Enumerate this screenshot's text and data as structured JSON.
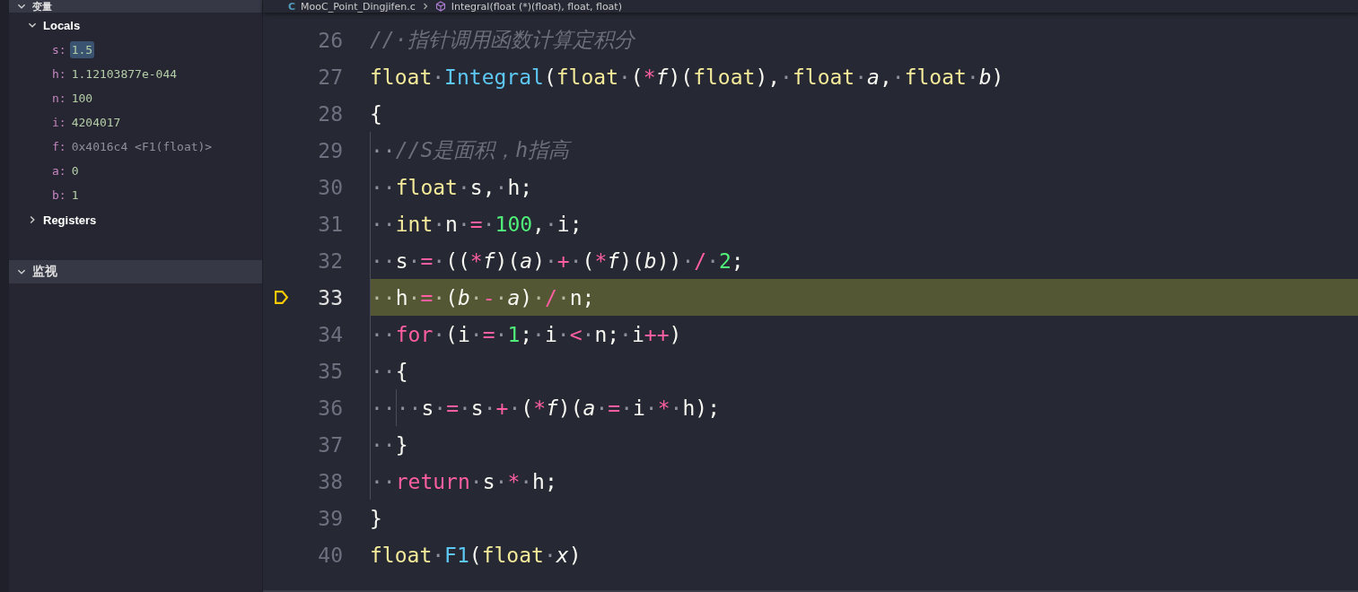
{
  "sidebar": {
    "section_title": "变量",
    "scopes": [
      {
        "label": "Locals",
        "expanded": true,
        "variables": [
          {
            "name": "s:",
            "value": "1.5",
            "selected": true,
            "kind": "number"
          },
          {
            "name": "h:",
            "value": "1.12103877e-044",
            "selected": false,
            "kind": "number"
          },
          {
            "name": "n:",
            "value": "100",
            "selected": false,
            "kind": "number"
          },
          {
            "name": "i:",
            "value": "4204017",
            "selected": false,
            "kind": "number"
          },
          {
            "name": "f:",
            "value": "0x4016c4 <F1(float)>",
            "selected": false,
            "kind": "pointer"
          },
          {
            "name": "a:",
            "value": "0",
            "selected": false,
            "kind": "number"
          },
          {
            "name": "b:",
            "value": "1",
            "selected": false,
            "kind": "number"
          }
        ]
      },
      {
        "label": "Registers",
        "expanded": false
      }
    ],
    "watch": {
      "title": "监视",
      "expanded": true
    }
  },
  "breadcrumb": {
    "file_icon": "C",
    "file": "MooC_Point_Dingjifen.c",
    "symbol": "Integral(float (*)(float), float, float)"
  },
  "editor": {
    "lines": [
      {
        "number": "26",
        "current": false,
        "tokens": [
          {
            "kind": "cm",
            "text": "//·指针调用函数计算定积分"
          }
        ]
      },
      {
        "number": "27",
        "current": false,
        "tokens": [
          {
            "kind": "ty",
            "text": "float"
          },
          {
            "kind": "ws",
            "text": "·"
          },
          {
            "kind": "fn",
            "text": "Integral"
          },
          {
            "kind": "pl",
            "text": "("
          },
          {
            "kind": "ty",
            "text": "float"
          },
          {
            "kind": "ws",
            "text": "·"
          },
          {
            "kind": "pl",
            "text": "("
          },
          {
            "kind": "op",
            "text": "*"
          },
          {
            "kind": "it",
            "text": "f"
          },
          {
            "kind": "pl",
            "text": ")("
          },
          {
            "kind": "ty",
            "text": "float"
          },
          {
            "kind": "pl",
            "text": "),"
          },
          {
            "kind": "ws",
            "text": "·"
          },
          {
            "kind": "ty",
            "text": "float"
          },
          {
            "kind": "ws",
            "text": "·"
          },
          {
            "kind": "it",
            "text": "a"
          },
          {
            "kind": "pl",
            "text": ","
          },
          {
            "kind": "ws",
            "text": "·"
          },
          {
            "kind": "ty",
            "text": "float"
          },
          {
            "kind": "ws",
            "text": "·"
          },
          {
            "kind": "it",
            "text": "b"
          },
          {
            "kind": "pl",
            "text": ")"
          }
        ]
      },
      {
        "number": "28",
        "current": false,
        "tokens": [
          {
            "kind": "pl",
            "text": "{"
          }
        ]
      },
      {
        "number": "29",
        "current": false,
        "tokens": [
          {
            "kind": "ind",
            "text": "··"
          },
          {
            "kind": "cm",
            "text": "//S是面积，h指高"
          }
        ]
      },
      {
        "number": "30",
        "current": false,
        "tokens": [
          {
            "kind": "ind",
            "text": "··"
          },
          {
            "kind": "ty",
            "text": "float"
          },
          {
            "kind": "ws",
            "text": "·"
          },
          {
            "kind": "pl",
            "text": "s,"
          },
          {
            "kind": "ws",
            "text": "·"
          },
          {
            "kind": "pl",
            "text": "h;"
          }
        ]
      },
      {
        "number": "31",
        "current": false,
        "tokens": [
          {
            "kind": "ind",
            "text": "··"
          },
          {
            "kind": "ty",
            "text": "int"
          },
          {
            "kind": "ws",
            "text": "·"
          },
          {
            "kind": "pl",
            "text": "n"
          },
          {
            "kind": "ws",
            "text": "·"
          },
          {
            "kind": "op",
            "text": "="
          },
          {
            "kind": "ws",
            "text": "·"
          },
          {
            "kind": "nu",
            "text": "100"
          },
          {
            "kind": "pl",
            "text": ","
          },
          {
            "kind": "ws",
            "text": "·"
          },
          {
            "kind": "pl",
            "text": "i;"
          }
        ]
      },
      {
        "number": "32",
        "current": false,
        "tokens": [
          {
            "kind": "ind",
            "text": "··"
          },
          {
            "kind": "pl",
            "text": "s"
          },
          {
            "kind": "ws",
            "text": "·"
          },
          {
            "kind": "op",
            "text": "="
          },
          {
            "kind": "ws",
            "text": "·"
          },
          {
            "kind": "pl",
            "text": "(("
          },
          {
            "kind": "op",
            "text": "*"
          },
          {
            "kind": "it",
            "text": "f"
          },
          {
            "kind": "pl",
            "text": ")("
          },
          {
            "kind": "it",
            "text": "a"
          },
          {
            "kind": "pl",
            "text": ")"
          },
          {
            "kind": "ws",
            "text": "·"
          },
          {
            "kind": "op",
            "text": "+"
          },
          {
            "kind": "ws",
            "text": "·"
          },
          {
            "kind": "pl",
            "text": "("
          },
          {
            "kind": "op",
            "text": "*"
          },
          {
            "kind": "it",
            "text": "f"
          },
          {
            "kind": "pl",
            "text": ")("
          },
          {
            "kind": "it",
            "text": "b"
          },
          {
            "kind": "pl",
            "text": "))"
          },
          {
            "kind": "ws",
            "text": "·"
          },
          {
            "kind": "op",
            "text": "/"
          },
          {
            "kind": "ws",
            "text": "·"
          },
          {
            "kind": "nu",
            "text": "2"
          },
          {
            "kind": "pl",
            "text": ";"
          }
        ]
      },
      {
        "number": "33",
        "current": true,
        "tokens": [
          {
            "kind": "ind",
            "text": "··"
          },
          {
            "kind": "pl",
            "text": "h"
          },
          {
            "kind": "ws",
            "text": "·"
          },
          {
            "kind": "op",
            "text": "="
          },
          {
            "kind": "ws",
            "text": "·"
          },
          {
            "kind": "pl",
            "text": "("
          },
          {
            "kind": "it",
            "text": "b"
          },
          {
            "kind": "ws",
            "text": "·"
          },
          {
            "kind": "op",
            "text": "-"
          },
          {
            "kind": "ws",
            "text": "·"
          },
          {
            "kind": "it",
            "text": "a"
          },
          {
            "kind": "pl",
            "text": ")"
          },
          {
            "kind": "ws",
            "text": "·"
          },
          {
            "kind": "op",
            "text": "/"
          },
          {
            "kind": "ws",
            "text": "·"
          },
          {
            "kind": "pl",
            "text": "n;"
          }
        ]
      },
      {
        "number": "34",
        "current": false,
        "tokens": [
          {
            "kind": "ind",
            "text": "··"
          },
          {
            "kind": "kw",
            "text": "for"
          },
          {
            "kind": "ws",
            "text": "·"
          },
          {
            "kind": "pl",
            "text": "(i"
          },
          {
            "kind": "ws",
            "text": "·"
          },
          {
            "kind": "op",
            "text": "="
          },
          {
            "kind": "ws",
            "text": "·"
          },
          {
            "kind": "nu",
            "text": "1"
          },
          {
            "kind": "pl",
            "text": ";"
          },
          {
            "kind": "ws",
            "text": "·"
          },
          {
            "kind": "pl",
            "text": "i"
          },
          {
            "kind": "ws",
            "text": "·"
          },
          {
            "kind": "op",
            "text": "<"
          },
          {
            "kind": "ws",
            "text": "·"
          },
          {
            "kind": "pl",
            "text": "n;"
          },
          {
            "kind": "ws",
            "text": "·"
          },
          {
            "kind": "pl",
            "text": "i"
          },
          {
            "kind": "op",
            "text": "++"
          },
          {
            "kind": "pl",
            "text": ")"
          }
        ]
      },
      {
        "number": "35",
        "current": false,
        "tokens": [
          {
            "kind": "ind",
            "text": "··"
          },
          {
            "kind": "pl",
            "text": "{"
          }
        ]
      },
      {
        "number": "36",
        "current": false,
        "tokens": [
          {
            "kind": "ind",
            "text": "··"
          },
          {
            "kind": "ind",
            "text": "··"
          },
          {
            "kind": "pl",
            "text": "s"
          },
          {
            "kind": "ws",
            "text": "·"
          },
          {
            "kind": "op",
            "text": "="
          },
          {
            "kind": "ws",
            "text": "·"
          },
          {
            "kind": "pl",
            "text": "s"
          },
          {
            "kind": "ws",
            "text": "·"
          },
          {
            "kind": "op",
            "text": "+"
          },
          {
            "kind": "ws",
            "text": "·"
          },
          {
            "kind": "pl",
            "text": "("
          },
          {
            "kind": "op",
            "text": "*"
          },
          {
            "kind": "it",
            "text": "f"
          },
          {
            "kind": "pl",
            "text": ")("
          },
          {
            "kind": "it",
            "text": "a"
          },
          {
            "kind": "ws",
            "text": "·"
          },
          {
            "kind": "op",
            "text": "="
          },
          {
            "kind": "ws",
            "text": "·"
          },
          {
            "kind": "pl",
            "text": "i"
          },
          {
            "kind": "ws",
            "text": "·"
          },
          {
            "kind": "op",
            "text": "*"
          },
          {
            "kind": "ws",
            "text": "·"
          },
          {
            "kind": "pl",
            "text": "h);"
          }
        ]
      },
      {
        "number": "37",
        "current": false,
        "tokens": [
          {
            "kind": "ind",
            "text": "··"
          },
          {
            "kind": "pl",
            "text": "}"
          }
        ]
      },
      {
        "number": "38",
        "current": false,
        "tokens": [
          {
            "kind": "ind",
            "text": "··"
          },
          {
            "kind": "kw",
            "text": "return"
          },
          {
            "kind": "ws",
            "text": "·"
          },
          {
            "kind": "pl",
            "text": "s"
          },
          {
            "kind": "ws",
            "text": "·"
          },
          {
            "kind": "op",
            "text": "*"
          },
          {
            "kind": "ws",
            "text": "·"
          },
          {
            "kind": "pl",
            "text": "h;"
          }
        ]
      },
      {
        "number": "39",
        "current": false,
        "tokens": [
          {
            "kind": "pl",
            "text": "}"
          }
        ]
      },
      {
        "number": "40",
        "current": false,
        "tokens": [
          {
            "kind": "ty",
            "text": "float"
          },
          {
            "kind": "ws",
            "text": "·"
          },
          {
            "kind": "fn",
            "text": "F1"
          },
          {
            "kind": "pl",
            "text": "("
          },
          {
            "kind": "ty",
            "text": "float"
          },
          {
            "kind": "ws",
            "text": "·"
          },
          {
            "kind": "it",
            "text": "x"
          },
          {
            "kind": "pl",
            "text": ")"
          }
        ]
      }
    ]
  }
}
